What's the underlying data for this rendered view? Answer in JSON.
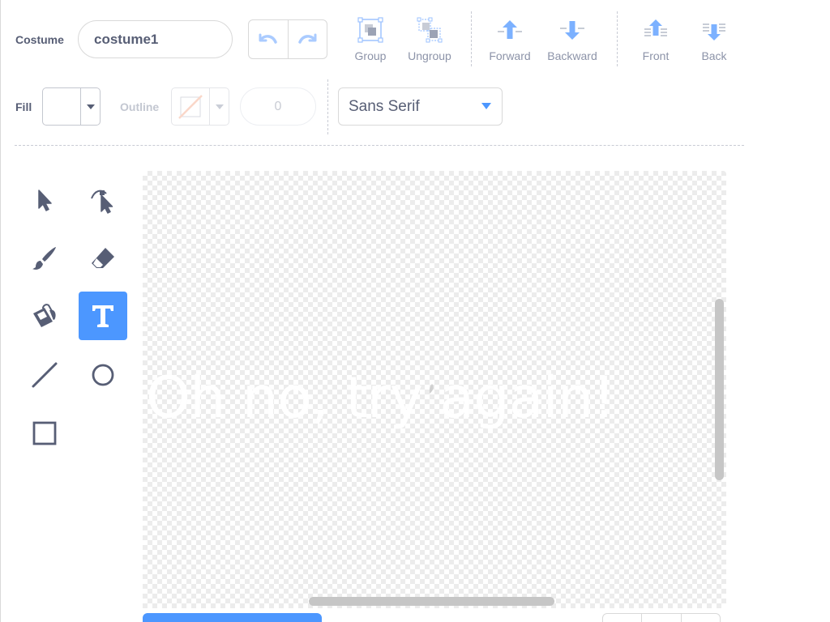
{
  "header": {
    "costume_label": "Costume",
    "costume_name": "costume1"
  },
  "arrange": {
    "group_label": "Group",
    "ungroup_label": "Ungroup",
    "forward_label": "Forward",
    "backward_label": "Backward",
    "front_label": "Front",
    "back_label": "Back"
  },
  "style": {
    "fill_label": "Fill",
    "fill_color": "#ffffff",
    "outline_label": "Outline",
    "outline_width": "0",
    "font_value": "Sans Serif"
  },
  "tools": [
    {
      "name": "select",
      "icon": "select-arrow-icon",
      "active": false
    },
    {
      "name": "reshape",
      "icon": "reshape-icon",
      "active": false
    },
    {
      "name": "brush",
      "icon": "brush-icon",
      "active": false
    },
    {
      "name": "eraser",
      "icon": "eraser-icon",
      "active": false
    },
    {
      "name": "fill",
      "icon": "paint-bucket-icon",
      "active": false
    },
    {
      "name": "text",
      "icon": "text-tool-icon",
      "active": true
    },
    {
      "name": "line",
      "icon": "line-icon",
      "active": false
    },
    {
      "name": "circle",
      "icon": "circle-icon",
      "active": false
    },
    {
      "name": "rectangle",
      "icon": "rectangle-icon",
      "active": false
    }
  ],
  "canvas": {
    "text": "Oh no, try again!"
  },
  "colors": {
    "accent": "#4c97ff",
    "icon_dark": "#575e75",
    "icon_light": "#4c97ff",
    "outline_none": "#f4a78a"
  }
}
